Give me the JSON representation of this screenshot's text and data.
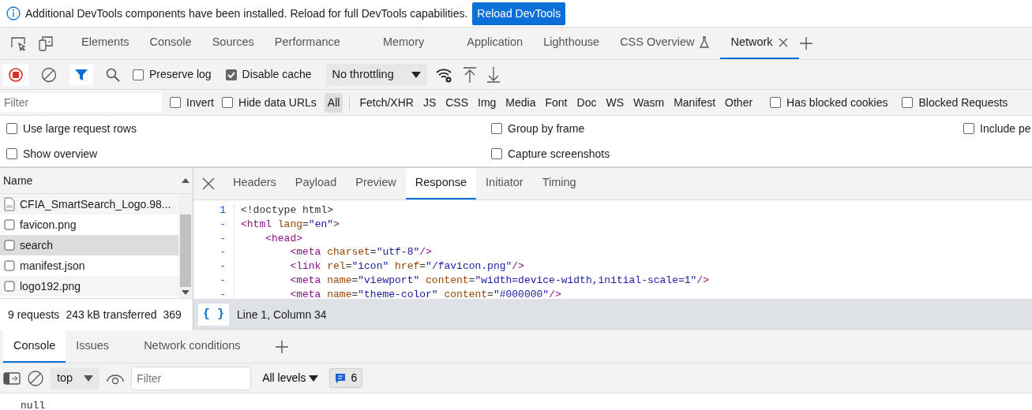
{
  "info_bar": {
    "message": "Additional DevTools components have been installed. Reload for full DevTools capabilities.",
    "button": "Reload DevTools"
  },
  "main_tabs": [
    {
      "label": "Elements",
      "kind": "plain",
      "selected": false
    },
    {
      "label": "Console",
      "kind": "plain",
      "selected": false
    },
    {
      "label": "Sources",
      "kind": "plain",
      "selected": false
    },
    {
      "label": "Performance",
      "kind": "plain",
      "selected": false
    },
    {
      "label": "Memory",
      "kind": "plain",
      "selected": false
    },
    {
      "label": "Application",
      "kind": "plain",
      "selected": false
    },
    {
      "label": "Lighthouse",
      "kind": "plain",
      "selected": false
    },
    {
      "label": "CSS Overview",
      "kind": "experimental",
      "selected": false
    },
    {
      "label": "Network",
      "kind": "closable",
      "selected": true
    }
  ],
  "network_toolbar": {
    "recording": true,
    "filter_active": true,
    "options": [
      {
        "label": "Preserve log",
        "checked": false
      },
      {
        "label": "Disable cache",
        "checked": true
      }
    ],
    "throttling": "No throttling"
  },
  "filter_bar": {
    "placeholder": "Filter",
    "options": [
      {
        "label": "Invert",
        "checked": false
      },
      {
        "label": "Hide data URLs",
        "checked": false
      }
    ],
    "types": [
      {
        "label": "All",
        "selected": true
      },
      {
        "label": "Fetch/XHR",
        "selected": false
      },
      {
        "label": "JS",
        "selected": false
      },
      {
        "label": "CSS",
        "selected": false
      },
      {
        "label": "Img",
        "selected": false
      },
      {
        "label": "Media",
        "selected": false
      },
      {
        "label": "Font",
        "selected": false
      },
      {
        "label": "Doc",
        "selected": false
      },
      {
        "label": "WS",
        "selected": false
      },
      {
        "label": "Wasm",
        "selected": false
      },
      {
        "label": "Manifest",
        "selected": false
      },
      {
        "label": "Other",
        "selected": false
      }
    ],
    "flags": [
      {
        "label": "Has blocked cookies",
        "checked": false
      },
      {
        "label": "Blocked Requests",
        "checked": false
      }
    ]
  },
  "settings": [
    [
      {
        "label": "Use large request rows",
        "checked": false
      },
      {
        "label": "Group by frame",
        "checked": false
      },
      {
        "label": "Include pe",
        "checked": false
      }
    ],
    [
      {
        "label": "Show overview",
        "checked": false
      },
      {
        "label": "Capture screenshots",
        "checked": false
      }
    ]
  ],
  "requests": {
    "column": "Name",
    "rows": [
      {
        "name": "CFIA_SmartSearch_Logo.98...",
        "kind": "document",
        "selected": false
      },
      {
        "name": "favicon.png",
        "kind": "file",
        "selected": false
      },
      {
        "name": "search",
        "kind": "file",
        "selected": true
      },
      {
        "name": "manifest.json",
        "kind": "file",
        "selected": false
      },
      {
        "name": "logo192.png",
        "kind": "file",
        "selected": false
      }
    ],
    "summary": [
      "9 requests",
      "243 kB transferred",
      "369"
    ]
  },
  "detail_tabs": [
    {
      "label": "Headers",
      "selected": false
    },
    {
      "label": "Payload",
      "selected": false
    },
    {
      "label": "Preview",
      "selected": false
    },
    {
      "label": "Response",
      "selected": true
    },
    {
      "label": "Initiator",
      "selected": false
    },
    {
      "label": "Timing",
      "selected": false
    }
  ],
  "code": [
    {
      "gutter": "1",
      "parts": [
        {
          "text": "<!doctype html>",
          "kind": "doctype"
        }
      ]
    },
    {
      "gutter": "-",
      "parts": [
        {
          "text": "<html",
          "kind": "tag"
        },
        {
          "text": " lang",
          "kind": "attr"
        },
        {
          "text": "=",
          "kind": "plain"
        },
        {
          "text": "\"en\"",
          "kind": "value"
        },
        {
          "text": ">",
          "kind": "tag"
        }
      ]
    },
    {
      "gutter": "-",
      "parts": [
        {
          "text": "    <head>",
          "kind": "tag"
        }
      ]
    },
    {
      "gutter": "-",
      "parts": [
        {
          "text": "        <meta",
          "kind": "tag"
        },
        {
          "text": " charset",
          "kind": "attr"
        },
        {
          "text": "=",
          "kind": "plain"
        },
        {
          "text": "\"utf-8\"",
          "kind": "value"
        },
        {
          "text": "/>",
          "kind": "tag"
        }
      ]
    },
    {
      "gutter": "-",
      "parts": [
        {
          "text": "        <link",
          "kind": "tag"
        },
        {
          "text": " rel",
          "kind": "attr"
        },
        {
          "text": "=",
          "kind": "plain"
        },
        {
          "text": "\"icon\"",
          "kind": "value"
        },
        {
          "text": " href",
          "kind": "attr"
        },
        {
          "text": "=",
          "kind": "plain"
        },
        {
          "text": "\"/favicon.png\"",
          "kind": "value"
        },
        {
          "text": "/>",
          "kind": "tag"
        }
      ]
    },
    {
      "gutter": "-",
      "parts": [
        {
          "text": "        <meta",
          "kind": "tag"
        },
        {
          "text": " name",
          "kind": "attr"
        },
        {
          "text": "=",
          "kind": "plain"
        },
        {
          "text": "\"viewport\"",
          "kind": "value"
        },
        {
          "text": " content",
          "kind": "attr"
        },
        {
          "text": "=",
          "kind": "plain"
        },
        {
          "text": "\"width=device-width,initial-scale=1\"",
          "kind": "value"
        },
        {
          "text": "/>",
          "kind": "tag"
        }
      ]
    },
    {
      "gutter": "-",
      "parts": [
        {
          "text": "        <meta",
          "kind": "tag"
        },
        {
          "text": " name",
          "kind": "attr"
        },
        {
          "text": "=",
          "kind": "plain"
        },
        {
          "text": "\"theme-color\"",
          "kind": "value"
        },
        {
          "text": " content",
          "kind": "attr"
        },
        {
          "text": "=",
          "kind": "plain"
        },
        {
          "text": "\"#000000\"",
          "kind": "value"
        },
        {
          "text": "/>",
          "kind": "tag"
        }
      ]
    }
  ],
  "status_bar": {
    "pretty_print": "{ }",
    "position": "Line 1, Column 34"
  },
  "drawer_tabs": [
    {
      "label": "Console",
      "selected": true
    },
    {
      "label": "Issues",
      "selected": false
    },
    {
      "label": "Network conditions",
      "selected": false
    }
  ],
  "console_toolbar": {
    "context": "top",
    "filter_placeholder": "Filter",
    "levels": "All levels",
    "messages": "6"
  },
  "console_output": [
    "null"
  ]
}
